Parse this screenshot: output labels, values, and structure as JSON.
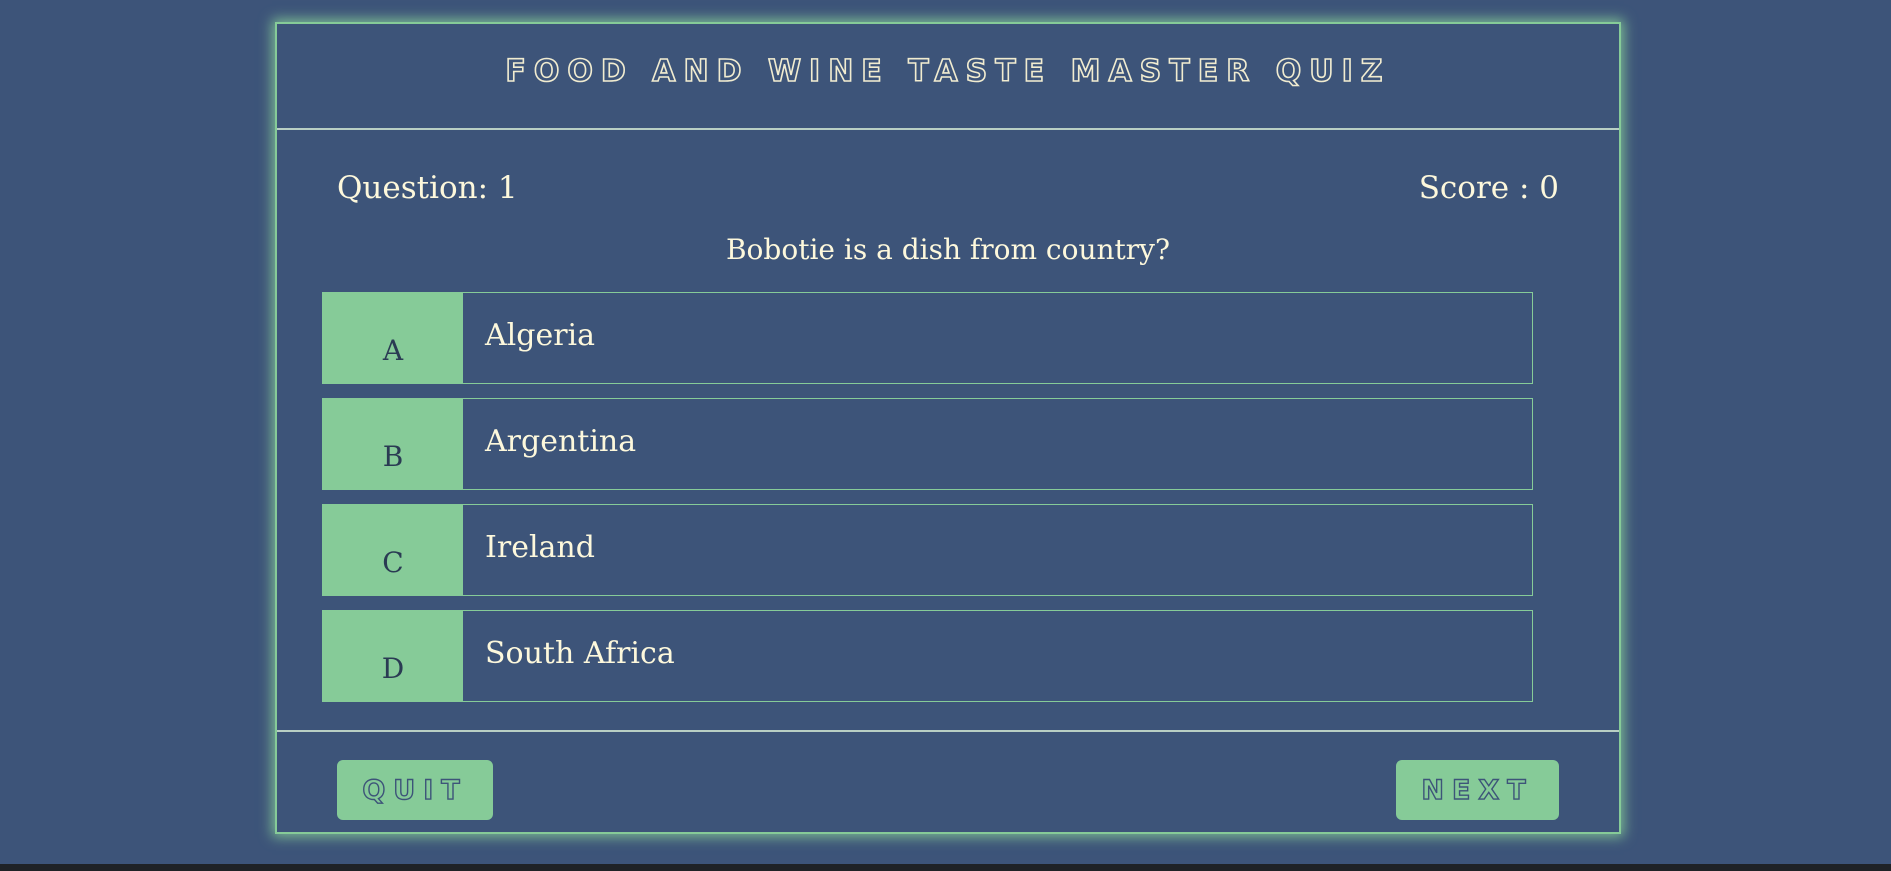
{
  "header": {
    "title": "Food and Wine Taste Master Quiz"
  },
  "status": {
    "question_label": "Question: 1",
    "score_label": "Score : 0"
  },
  "question": {
    "text": "Bobotie is a dish from country?"
  },
  "answers": [
    {
      "letter": "A",
      "text": "Algeria"
    },
    {
      "letter": "B",
      "text": "Argentina"
    },
    {
      "letter": "C",
      "text": "Ireland"
    },
    {
      "letter": "D",
      "text": "South Africa"
    }
  ],
  "footer": {
    "quit_label": "Quit",
    "next_label": "Next"
  },
  "colors": {
    "background": "#3d5479",
    "accent": "#86cb98",
    "text": "#fdf8dc"
  }
}
